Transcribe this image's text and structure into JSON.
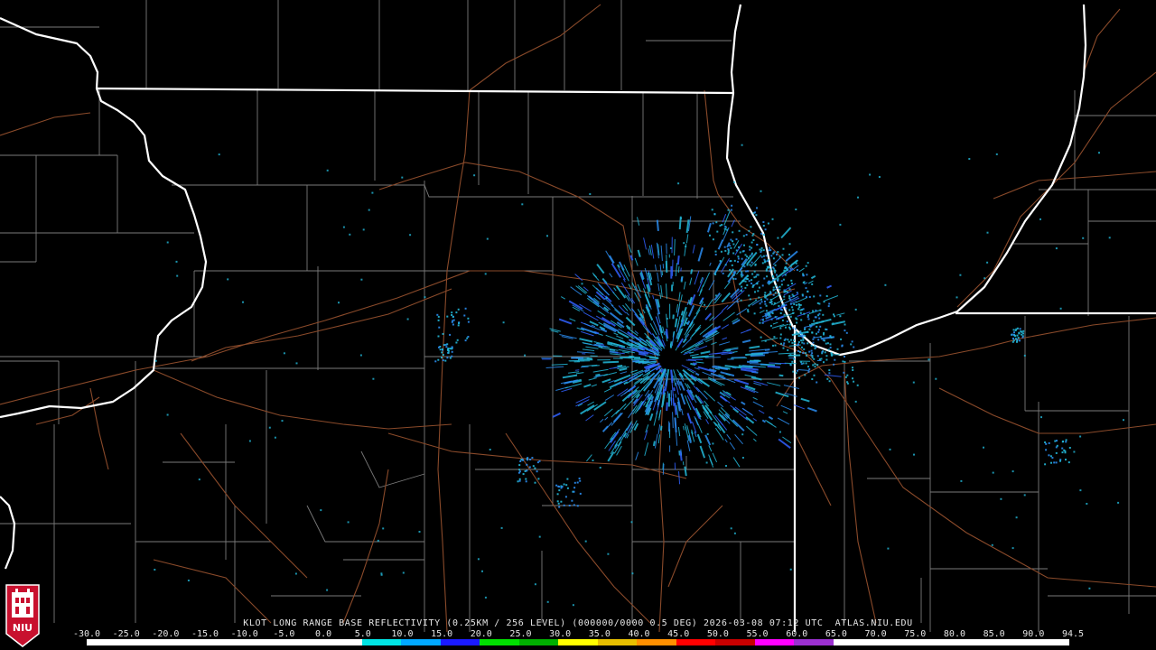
{
  "product": {
    "caption": "KLOT LONG RANGE BASE REFLECTIVITY (0.25KM / 256 LEVEL) (000000/0000 0.5 DEG) 2026-03-08 07:12 UTC  ATLAS.NIU.EDU"
  },
  "logo": {
    "text": "NIU",
    "color": "#c8102e"
  },
  "scale": {
    "labels": [
      "-30.0",
      "-25.0",
      "-20.0",
      "-15.0",
      "-10.0",
      "-5.0",
      "0.0",
      "5.0",
      "10.0",
      "15.0",
      "20.0",
      "25.0",
      "30.0",
      "35.0",
      "40.0",
      "45.0",
      "50.0",
      "55.0",
      "60.0",
      "65.0",
      "70.0",
      "75.0",
      "80.0",
      "85.0",
      "90.0",
      "94.5"
    ],
    "colors": [
      "#ffffff",
      "#ffffff",
      "#ffffff",
      "#ffffff",
      "#ffffff",
      "#ffffff",
      "#ffffff",
      "#00e5e5",
      "#00a8ff",
      "#1a1aff",
      "#00e000",
      "#00b000",
      "#ffff00",
      "#e8c000",
      "#ff9000",
      "#ff0000",
      "#c80000",
      "#ff00ff",
      "#9b30d0",
      "#ffffff",
      "#ffffff",
      "#ffffff",
      "#ffffff",
      "#ffffff",
      "#ffffff"
    ]
  },
  "map_colors": {
    "background": "#000000",
    "state_border": "#ffffff",
    "county_border": "#7a7a7a",
    "highway": "#8a4a2a",
    "echo_light": "#22b8d8",
    "echo_mid": "#2a8cf0",
    "echo_strong": "#3060ff"
  }
}
